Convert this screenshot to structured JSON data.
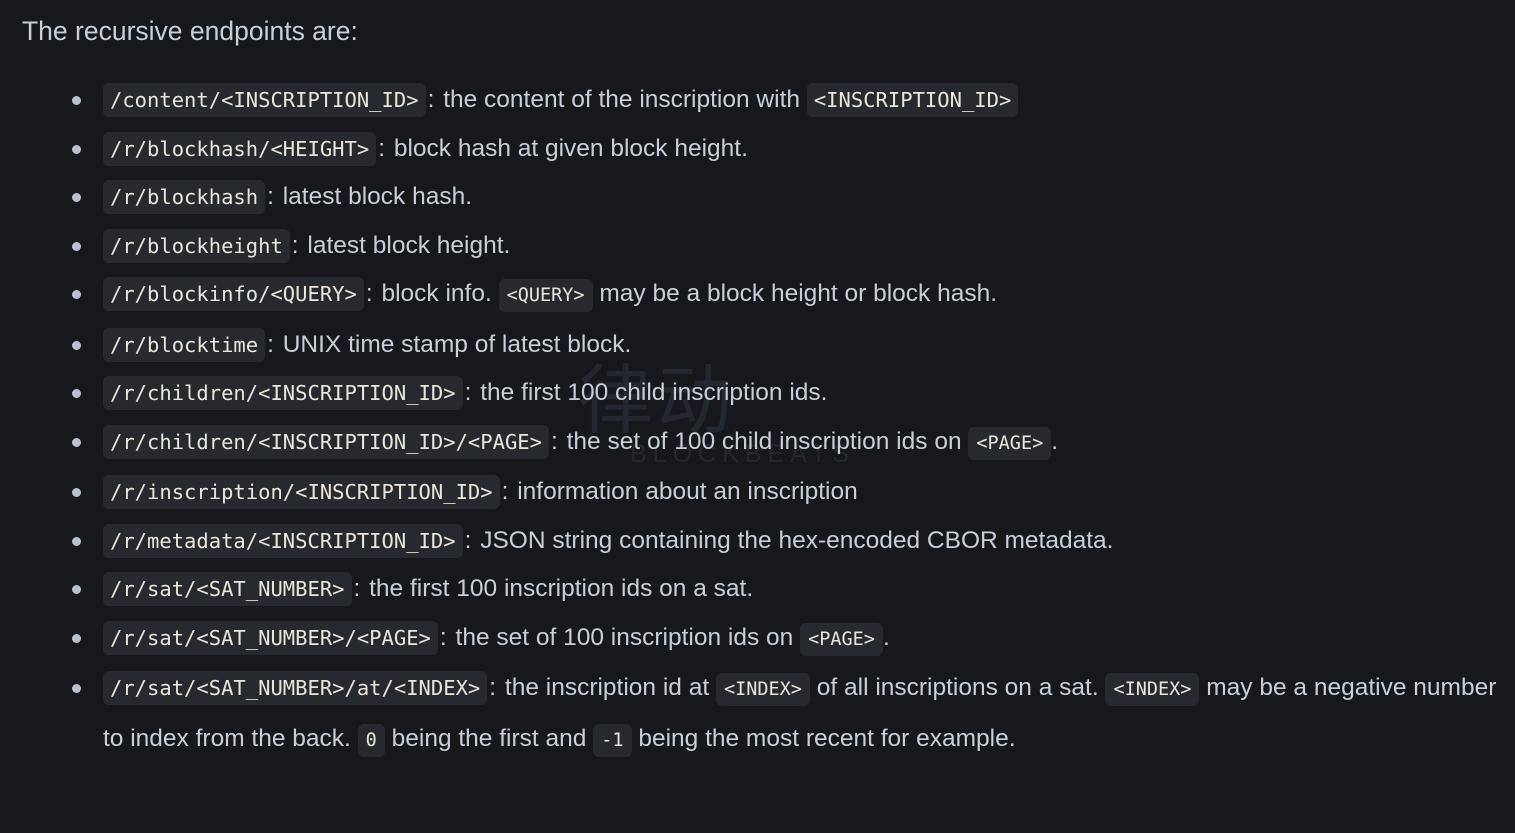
{
  "page": {
    "intro": "The recursive endpoints are:",
    "background_color": "#16181c",
    "text_color": "#c7d0d9",
    "code_background": "#262a2f",
    "code_text_color": "#ece6da",
    "bullet_color": "#b9c2cc"
  },
  "watermark": {
    "mark": "律动",
    "word": "BLOCKBEATS"
  },
  "endpoints": [
    {
      "path": "/content/<INSCRIPTION_ID>",
      "sep": ":",
      "desc_1": "the content of the inscription with",
      "code_1": "<INSCRIPTION_ID>",
      "desc_2": ""
    },
    {
      "path": "/r/blockhash/<HEIGHT>",
      "sep": ":",
      "desc_1": "block hash at given block height.",
      "code_1": "",
      "desc_2": ""
    },
    {
      "path": "/r/blockhash",
      "sep": ":",
      "desc_1": "latest block hash.",
      "code_1": "",
      "desc_2": ""
    },
    {
      "path": "/r/blockheight",
      "sep": ":",
      "desc_1": "latest block height.",
      "code_1": "",
      "desc_2": ""
    },
    {
      "path": "/r/blockinfo/<QUERY>",
      "sep": ":",
      "desc_1": "block info.",
      "code_1": "<QUERY>",
      "desc_2": "may be a block height or block hash."
    },
    {
      "path": "/r/blocktime",
      "sep": ":",
      "desc_1": "UNIX time stamp of latest block.",
      "code_1": "",
      "desc_2": ""
    },
    {
      "path": "/r/children/<INSCRIPTION_ID>",
      "sep": ":",
      "desc_1": "the first 100 child inscription ids.",
      "code_1": "",
      "desc_2": ""
    },
    {
      "path": "/r/children/<INSCRIPTION_ID>/<PAGE>",
      "sep": ":",
      "desc_1": "the set of 100 child inscription ids on",
      "code_1": "<PAGE>",
      "desc_2": "."
    },
    {
      "path": "/r/inscription/<INSCRIPTION_ID>",
      "sep": ":",
      "desc_1": "information about an inscription",
      "code_1": "",
      "desc_2": ""
    },
    {
      "path": "/r/metadata/<INSCRIPTION_ID>",
      "sep": ":",
      "desc_1": "JSON string containing the hex-encoded CBOR metadata.",
      "code_1": "",
      "desc_2": ""
    },
    {
      "path": "/r/sat/<SAT_NUMBER>",
      "sep": ":",
      "desc_1": "the first 100 inscription ids on a sat.",
      "code_1": "",
      "desc_2": ""
    },
    {
      "path": "/r/sat/<SAT_NUMBER>/<PAGE>",
      "sep": ":",
      "desc_1": "the set of 100 inscription ids on",
      "code_1": "<PAGE>",
      "desc_2": "."
    }
  ],
  "last_endpoint": {
    "path": "/r/sat/<SAT_NUMBER>/at/<INDEX>",
    "sep": ":",
    "desc_1": "the inscription id at",
    "code_1": "<INDEX>",
    "desc_2": "of all inscriptions on a sat.",
    "code_2": "<INDEX>",
    "desc_3": "may be a negative number to index from the back.",
    "code_3": "0",
    "desc_4": "being the first and",
    "code_4": "-1",
    "desc_5": "being the most recent for example."
  }
}
